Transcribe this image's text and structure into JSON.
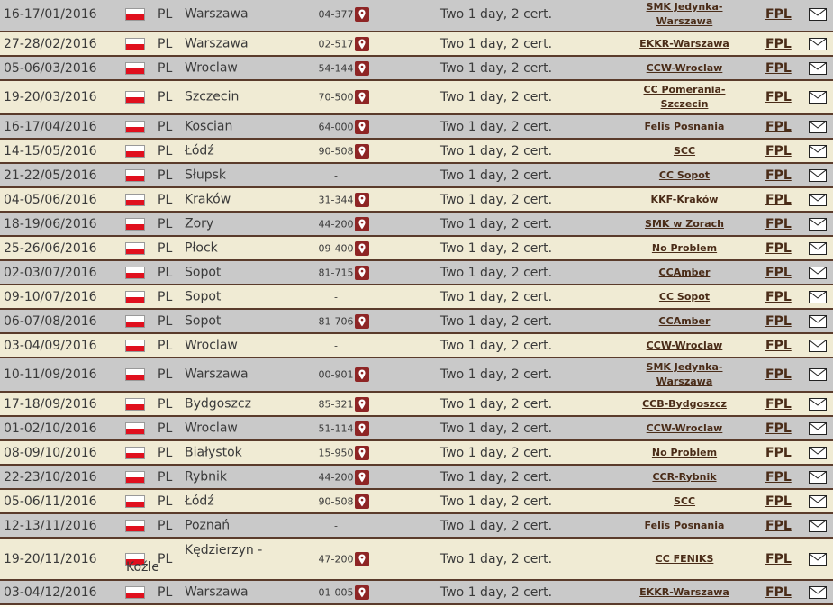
{
  "rows": [
    {
      "date": "16-17/01/2016",
      "country": "PL",
      "city": "Warszawa",
      "zip": "04-377",
      "course": "Two 1 day, 2 cert.",
      "organizer": "SMK Jedynka-Warszawa",
      "link": "FPL",
      "map": true
    },
    {
      "date": "27-28/02/2016",
      "country": "PL",
      "city": "Warszawa",
      "zip": "02-517",
      "course": "Two 1 day, 2 cert.",
      "organizer": "EKKR-Warszawa",
      "link": "FPL",
      "map": true
    },
    {
      "date": "05-06/03/2016",
      "country": "PL",
      "city": "Wroclaw",
      "zip": "54-144",
      "course": "Two 1 day, 2 cert.",
      "organizer": "CCW-Wroclaw",
      "link": "FPL",
      "map": true
    },
    {
      "date": "19-20/03/2016",
      "country": "PL",
      "city": "Szczecin",
      "zip": "70-500",
      "course": "Two 1 day, 2 cert.",
      "organizer": "CC Pomerania-Szczecin",
      "link": "FPL",
      "map": true
    },
    {
      "date": "16-17/04/2016",
      "country": "PL",
      "city": "Koscian",
      "zip": "64-000",
      "course": "Two 1 day, 2 cert.",
      "organizer": "Felis Posnania",
      "link": "FPL",
      "map": true
    },
    {
      "date": "14-15/05/2016",
      "country": "PL",
      "city": "Łódź",
      "zip": "90-508",
      "course": "Two 1 day, 2 cert.",
      "organizer": "SCC",
      "link": "FPL",
      "map": true
    },
    {
      "date": "21-22/05/2016",
      "country": "PL",
      "city": "Słupsk",
      "zip": "-",
      "course": "Two 1 day, 2 cert.",
      "organizer": "CC Sopot",
      "link": "FPL",
      "map": false
    },
    {
      "date": "04-05/06/2016",
      "country": "PL",
      "city": "Kraków",
      "zip": "31-344",
      "course": "Two 1 day, 2 cert.",
      "organizer": "KKF-Kraków",
      "link": "FPL",
      "map": true
    },
    {
      "date": "18-19/06/2016",
      "country": "PL",
      "city": "Zory",
      "zip": "44-200",
      "course": "Two 1 day, 2 cert.",
      "organizer": "SMK w Zorach",
      "link": "FPL",
      "map": true
    },
    {
      "date": "25-26/06/2016",
      "country": "PL",
      "city": "Płock",
      "zip": "09-400",
      "course": "Two 1 day, 2 cert.",
      "organizer": "No Problem",
      "link": "FPL",
      "map": true
    },
    {
      "date": "02-03/07/2016",
      "country": "PL",
      "city": "Sopot",
      "zip": "81-715",
      "course": "Two 1 day, 2 cert.",
      "organizer": "CCAmber",
      "link": "FPL",
      "map": true
    },
    {
      "date": "09-10/07/2016",
      "country": "PL",
      "city": "Sopot",
      "zip": "-",
      "course": "Two 1 day, 2 cert.",
      "organizer": "CC Sopot",
      "link": "FPL",
      "map": false
    },
    {
      "date": "06-07/08/2016",
      "country": "PL",
      "city": "Sopot",
      "zip": "81-706",
      "course": "Two 1 day, 2 cert.",
      "organizer": "CCAmber",
      "link": "FPL",
      "map": true
    },
    {
      "date": "03-04/09/2016",
      "country": "PL",
      "city": "Wroclaw",
      "zip": "-",
      "course": "Two 1 day, 2 cert.",
      "organizer": "CCW-Wroclaw",
      "link": "FPL",
      "map": false
    },
    {
      "date": "10-11/09/2016",
      "country": "PL",
      "city": "Warszawa",
      "zip": "00-901",
      "course": "Two 1 day, 2 cert.",
      "organizer": "SMK Jedynka-Warszawa",
      "link": "FPL",
      "map": true
    },
    {
      "date": "17-18/09/2016",
      "country": "PL",
      "city": "Bydgoszcz",
      "zip": "85-321",
      "course": "Two 1 day, 2 cert.",
      "organizer": "CCB-Bydgoszcz",
      "link": "FPL",
      "map": true
    },
    {
      "date": "01-02/10/2016",
      "country": "PL",
      "city": "Wroclaw",
      "zip": "51-114",
      "course": "Two 1 day, 2 cert.",
      "organizer": "CCW-Wroclaw",
      "link": "FPL",
      "map": true
    },
    {
      "date": "08-09/10/2016",
      "country": "PL",
      "city": "Białystok",
      "zip": "15-950",
      "course": "Two 1 day, 2 cert.",
      "organizer": "No Problem",
      "link": "FPL",
      "map": true
    },
    {
      "date": "22-23/10/2016",
      "country": "PL",
      "city": "Rybnik",
      "zip": "44-200",
      "course": "Two 1 day, 2 cert.",
      "organizer": "CCR-Rybnik",
      "link": "FPL",
      "map": true
    },
    {
      "date": "05-06/11/2016",
      "country": "PL",
      "city": "Łódź",
      "zip": "90-508",
      "course": "Two 1 day, 2 cert.",
      "organizer": "SCC",
      "link": "FPL",
      "map": true
    },
    {
      "date": "12-13/11/2016",
      "country": "PL",
      "city": "Poznań",
      "zip": "-",
      "course": "Two 1 day, 2 cert.",
      "organizer": "Felis Posnania",
      "link": "FPL",
      "map": false
    },
    {
      "date": "19-20/11/2016",
      "country": "PL",
      "city": "Kędzierzyn - Koźle",
      "zip": "47-200",
      "course": "Two 1 day, 2 cert.",
      "organizer": "CC FENIKS",
      "link": "FPL",
      "map": true
    },
    {
      "date": "03-04/12/2016",
      "country": "PL",
      "city": "Warszawa",
      "zip": "01-005",
      "course": "Two 1 day, 2 cert.",
      "organizer": "EKKR-Warszawa",
      "link": "FPL",
      "map": true
    }
  ]
}
